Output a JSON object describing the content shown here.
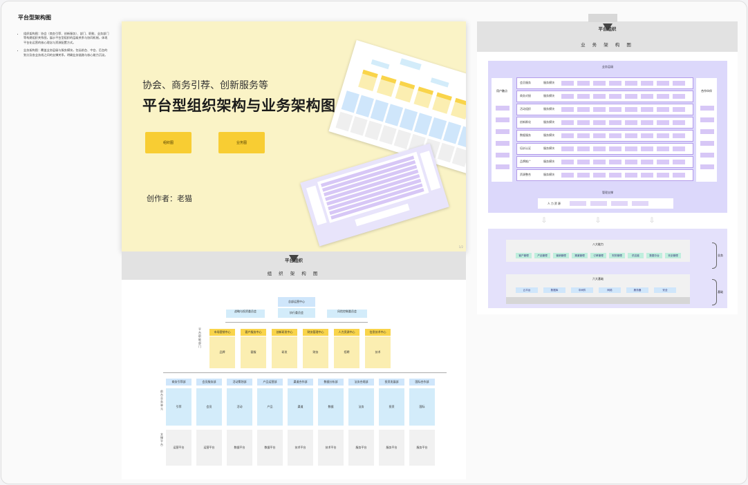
{
  "doc": {
    "title": "平台型架构图",
    "notes": [
      "组织架构图：协会（商务引荐、创新服务）、部门、职能、业务部门等构建组织关系图，展示平台型组织的层级关系与协同机制，体现平台化运营的核心理念与资源配置方式。",
      "业务架构图：覆盖业务层级与服务模块，包括前台、中台、后台的划分及各业务线之间的支撑关系，明确业务链路与核心能力沉淀。"
    ]
  },
  "cover": {
    "subtitle": "协会、商务引荐、创新服务等",
    "title": "平台型组织架构与业务架构图",
    "button1": "组织图",
    "button2": "业务图",
    "author": "创作者：老猫",
    "page": "1/2"
  },
  "org": {
    "logo": "平台组织",
    "title": "组 织 架 构 图",
    "top_box": "总部运营中心",
    "top_box2": "执行委员会",
    "left_box": "战略与投资委员会",
    "right_box": "风险控制委员会",
    "left_label_1": "平台职能部门",
    "left_label_2": "前台业务单元",
    "left_label_3": "支撑平台",
    "mid_heads": [
      "市场营销中心",
      "客户服务中心",
      "创新研发中心",
      "财务管理中心",
      "人力资源中心",
      "信息技术中心"
    ],
    "mid_bodies": [
      "品牌",
      "客服",
      "研发",
      "财务",
      "招聘",
      "技术"
    ],
    "low_heads": [
      "商务引荐部",
      "会员服务部",
      "活动策划部",
      "产品运营部",
      "渠道合作部",
      "数据分析部",
      "法务合规部",
      "投资发展部",
      "国际合作部"
    ],
    "low_bodies": [
      "引荐",
      "会员",
      "活动",
      "产品",
      "渠道",
      "数据",
      "法务",
      "投资",
      "国际"
    ],
    "base_bodies": [
      "运营平台",
      "运营平台",
      "数据平台",
      "数据平台",
      "技术平台",
      "技术平台",
      "服务平台",
      "服务平台",
      "服务平台"
    ]
  },
  "biz": {
    "logo": "平台组织",
    "title": "业 务 架 构 图",
    "section_top": "业务层级",
    "left_side": "用户触点",
    "right_side": "合作伙伴",
    "rows": [
      "会员服务",
      "商务对接",
      "活动组织",
      "创新孵化",
      "数据服务",
      "培训认证",
      "品牌推广",
      "资源整合"
    ],
    "row_tags": [
      "服务模块",
      "服务模块",
      "服务模块",
      "服务模块",
      "服务模块",
      "服务模块",
      "服务模块",
      "服务模块"
    ],
    "support_title": "管理支撑",
    "support_item": "人 力 资 源",
    "middle_title": "八大能力",
    "middle_chips": [
      "客户管理",
      "产品管理",
      "营销管理",
      "渠道管理",
      "订单管理",
      "财务管理",
      "供应链",
      "数据中台",
      "安全管理"
    ],
    "bottom_title": "六大基础",
    "bottom_chips": [
      "云平台",
      "数据库",
      "中间件",
      "网络",
      "服务器",
      "安全"
    ],
    "brace1": "业务",
    "brace2": "基础"
  }
}
